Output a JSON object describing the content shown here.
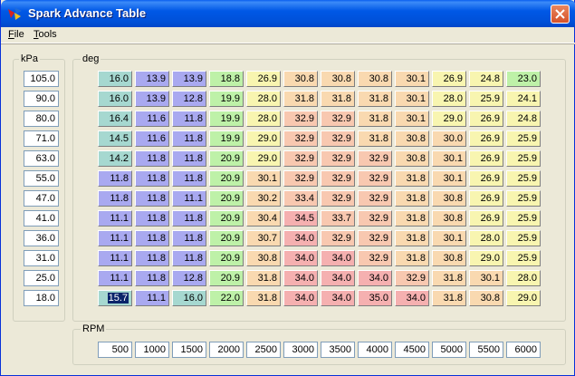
{
  "window": {
    "title": "Spark Advance Table"
  },
  "menu": {
    "items": [
      "File",
      "Tools"
    ]
  },
  "kpa": {
    "label": "kPa",
    "values": [
      "105.0",
      "90.0",
      "80.0",
      "71.0",
      "63.0",
      "55.0",
      "47.0",
      "41.0",
      "36.0",
      "31.0",
      "25.0",
      "18.0"
    ]
  },
  "deg": {
    "label": "deg",
    "rows": [
      [
        "16.0",
        "13.9",
        "13.9",
        "18.8",
        "26.9",
        "30.8",
        "30.8",
        "30.8",
        "30.1",
        "26.9",
        "24.8",
        "23.0"
      ],
      [
        "16.0",
        "13.9",
        "12.8",
        "19.9",
        "28.0",
        "31.8",
        "31.8",
        "31.8",
        "30.1",
        "28.0",
        "25.9",
        "24.1"
      ],
      [
        "16.4",
        "11.6",
        "11.8",
        "19.9",
        "28.0",
        "32.9",
        "32.9",
        "31.8",
        "30.1",
        "29.0",
        "26.9",
        "24.8"
      ],
      [
        "14.5",
        "11.6",
        "11.8",
        "19.9",
        "29.0",
        "32.9",
        "32.9",
        "31.8",
        "30.8",
        "30.0",
        "26.9",
        "25.9"
      ],
      [
        "14.2",
        "11.8",
        "11.8",
        "20.9",
        "29.0",
        "32.9",
        "32.9",
        "32.9",
        "30.8",
        "30.1",
        "26.9",
        "25.9"
      ],
      [
        "11.8",
        "11.8",
        "11.8",
        "20.9",
        "30.1",
        "32.9",
        "32.9",
        "32.9",
        "31.8",
        "30.1",
        "26.9",
        "25.9"
      ],
      [
        "11.8",
        "11.8",
        "11.1",
        "20.9",
        "30.2",
        "33.4",
        "32.9",
        "32.9",
        "31.8",
        "30.8",
        "26.9",
        "25.9"
      ],
      [
        "11.1",
        "11.8",
        "11.8",
        "20.9",
        "30.4",
        "34.5",
        "33.7",
        "32.9",
        "31.8",
        "30.8",
        "26.9",
        "25.9"
      ],
      [
        "11.1",
        "11.8",
        "11.8",
        "20.9",
        "30.7",
        "34.0",
        "32.9",
        "32.9",
        "31.8",
        "30.1",
        "28.0",
        "25.9"
      ],
      [
        "11.1",
        "11.8",
        "11.8",
        "20.9",
        "30.8",
        "34.0",
        "34.0",
        "32.9",
        "31.8",
        "30.8",
        "29.0",
        "25.9"
      ],
      [
        "11.1",
        "11.8",
        "12.8",
        "20.9",
        "31.8",
        "34.0",
        "34.0",
        "34.0",
        "32.9",
        "31.8",
        "30.1",
        "28.0"
      ],
      [
        "15.7",
        "11.1",
        "16.0",
        "22.0",
        "31.8",
        "34.0",
        "34.0",
        "35.0",
        "34.0",
        "31.8",
        "30.8",
        "29.0"
      ]
    ],
    "selected": {
      "row": 11,
      "col": 0
    }
  },
  "rpm": {
    "label": "RPM",
    "values": [
      "500",
      "1000",
      "1500",
      "2000",
      "2500",
      "3000",
      "3500",
      "4000",
      "4500",
      "5000",
      "5500",
      "6000"
    ]
  },
  "colors": {
    "blue": "#A9A9F0",
    "teal": "#A6D8D0",
    "green": "#BEF1A8",
    "yellow": "#F8F5B0",
    "orange": "#F9D9B0",
    "salmon": "#F8C8B0",
    "red": "#F5B0B0",
    "selection": "#0A246A"
  }
}
